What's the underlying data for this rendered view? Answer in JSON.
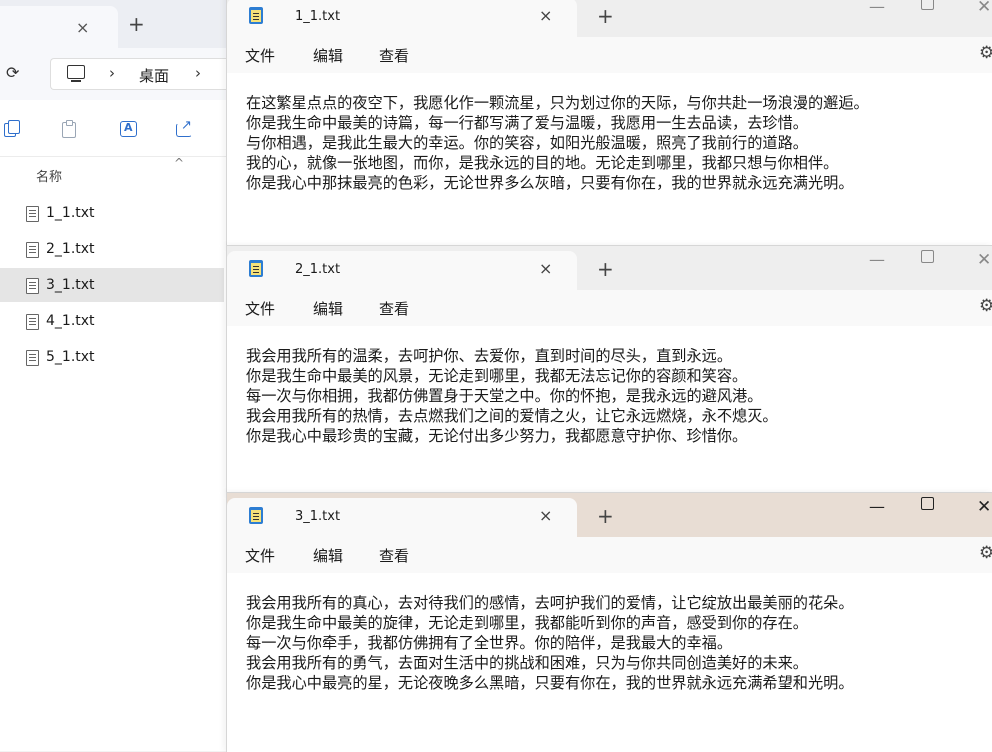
{
  "explorer": {
    "tab_close": "×",
    "new_tab": "+",
    "refresh_icon": "⟳",
    "address_sep": "›",
    "breadcrumb": "桌面",
    "column_name": "名称",
    "sort_caret": "^",
    "files": [
      {
        "name": "1_1.txt",
        "selected": false
      },
      {
        "name": "2_1.txt",
        "selected": false
      },
      {
        "name": "3_1.txt",
        "selected": true
      },
      {
        "name": "4_1.txt",
        "selected": false
      },
      {
        "name": "5_1.txt",
        "selected": false
      }
    ]
  },
  "notepad": {
    "menu": {
      "file": "文件",
      "edit": "编辑",
      "view": "查看"
    },
    "tab_close": "×",
    "new_tab": "+",
    "minimize": "—",
    "close": "✕",
    "settings_icon": "⚙",
    "windows": [
      {
        "title": "1_1.txt",
        "active": false,
        "lines": [
          "在这繁星点点的夜空下，我愿化作一颗流星，只为划过你的天际，与你共赴一场浪漫的邂逅。",
          "你是我生命中最美的诗篇，每一行都写满了爱与温暖，我愿用一生去品读，去珍惜。",
          "与你相遇，是我此生最大的幸运。你的笑容，如阳光般温暖，照亮了我前行的道路。",
          "我的心，就像一张地图，而你，是我永远的目的地。无论走到哪里，我都只想与你相伴。",
          "你是我心中那抹最亮的色彩，无论世界多么灰暗，只要有你在，我的世界就永远充满光明。"
        ]
      },
      {
        "title": "2_1.txt",
        "active": false,
        "lines": [
          "我会用我所有的温柔，去呵护你、去爱你，直到时间的尽头，直到永远。",
          "你是我生命中最美的风景，无论走到哪里，我都无法忘记你的容颜和笑容。",
          "每一次与你相拥，我都仿佛置身于天堂之中。你的怀抱，是我永远的避风港。",
          "我会用我所有的热情，去点燃我们之间的爱情之火，让它永远燃烧，永不熄灭。",
          "你是我心中最珍贵的宝藏，无论付出多少努力，我都愿意守护你、珍惜你。"
        ]
      },
      {
        "title": "3_1.txt",
        "active": true,
        "lines": [
          "我会用我所有的真心，去对待我们的感情，去呵护我们的爱情，让它绽放出最美丽的花朵。",
          "你是我生命中最美的旋律，无论走到哪里，我都能听到你的声音，感受到你的存在。",
          "每一次与你牵手，我都仿佛拥有了全世界。你的陪伴，是我最大的幸福。",
          "我会用我所有的勇气，去面对生活中的挑战和困难，只为与你共同创造美好的未来。",
          "你是我心中最亮的星，无论夜晚多么黑暗，只要有你在，我的世界就永远充满希望和光明。"
        ]
      }
    ]
  }
}
